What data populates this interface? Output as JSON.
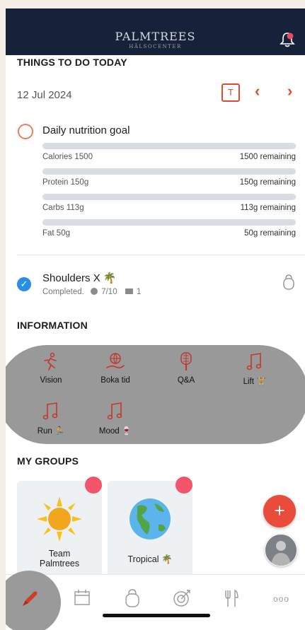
{
  "header": {
    "brand": "PALMTREES",
    "brand_sub": "HÄLSOCENTER",
    "bell_icon": "bell-icon",
    "notification_dot_color": "#e84a5f"
  },
  "today": {
    "section_title": "THINGS TO DO TODAY",
    "date": "12 Jul 2024",
    "today_button": "T",
    "prev": "‹",
    "next": "›"
  },
  "nutrition": {
    "title": "Daily nutrition goal",
    "rows": [
      {
        "label": "Calories 1500",
        "remaining": "1500 remaining",
        "progress": 0
      },
      {
        "label": "Protein 150g",
        "remaining": "150g remaining",
        "progress": 0
      },
      {
        "label": "Carbs 113g",
        "remaining": "113g remaining",
        "progress": 0
      },
      {
        "label": "Fat 50g",
        "remaining": "50g remaining",
        "progress": 0
      }
    ]
  },
  "workout": {
    "title": "Shoulders X 🌴",
    "status": "Completed.",
    "score": "7/10",
    "comments": "1"
  },
  "information": {
    "section_title": "INFORMATION",
    "items": [
      {
        "label": "Vision",
        "icon": "running-person-icon"
      },
      {
        "label": "Boka tid",
        "icon": "globe-hand-icon"
      },
      {
        "label": "Q&A",
        "icon": "racket-icon"
      },
      {
        "label": "Lift 🏋️",
        "icon": "music-note-icon"
      },
      {
        "label": "Run 🏃",
        "icon": "music-note-icon"
      },
      {
        "label": "Mood 🍷",
        "icon": "music-note-icon"
      }
    ]
  },
  "groups": {
    "section_title": "MY GROUPS",
    "items": [
      {
        "name": "Team Palmtrees",
        "icon": "sun-icon"
      },
      {
        "name": "Tropical 🌴",
        "icon": "globe-icon"
      }
    ]
  },
  "fab": {
    "label": "+"
  },
  "tabs": [
    "rocket-icon",
    "calendar-icon",
    "kettlebell-icon",
    "target-icon",
    "utensils-icon",
    "more-icon"
  ],
  "tab_more_label": "ooo",
  "colors": {
    "accent": "#e04a2f",
    "navy": "#16223a",
    "check": "#2a8de6"
  }
}
